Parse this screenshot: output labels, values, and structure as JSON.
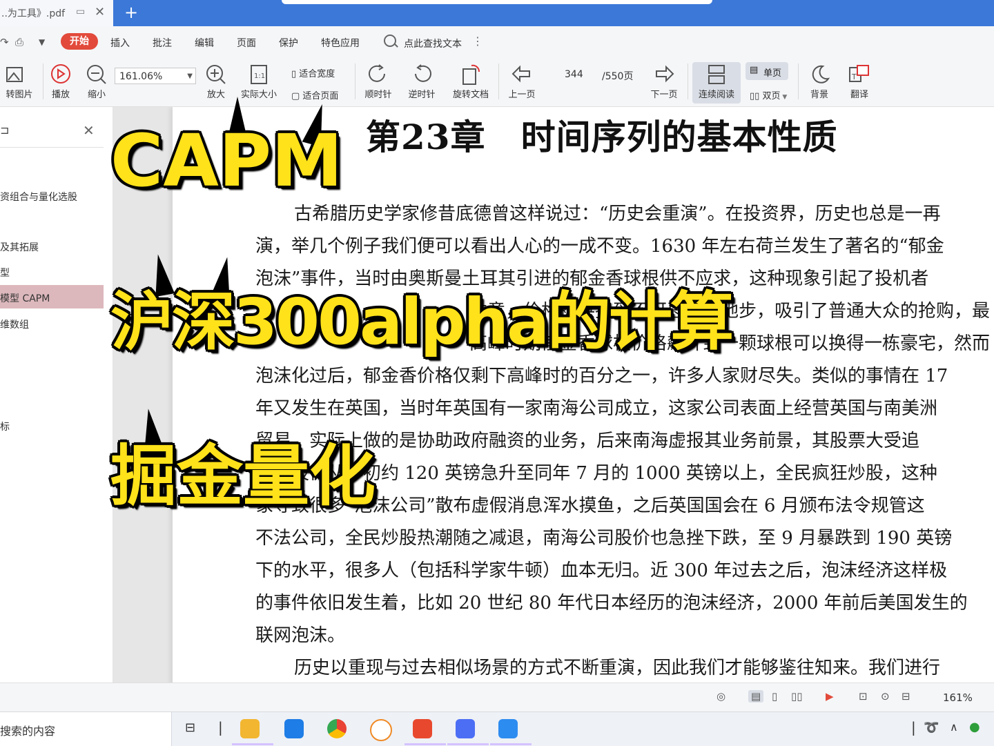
{
  "tab": {
    "title": "..为工具》.pdf",
    "new_tab": "+"
  },
  "menu": {
    "items": [
      "开始",
      "插入",
      "批注",
      "编辑",
      "页面",
      "保护",
      "特色应用"
    ],
    "search_text": "点此查找文本",
    "more": "⋮"
  },
  "toolbar": {
    "to_image": "转图片",
    "play": "播放",
    "zoom_out": "缩小",
    "zoom_value": "161.06%",
    "zoom_in": "放大",
    "actual_size": "实际大小",
    "fit_width": "适合宽度",
    "fit_page": "适合页面",
    "rotate_cw": "顺时针",
    "rotate_ccw": "逆时针",
    "rotate_doc": "旋转文档",
    "prev_page": "上一页",
    "page_current": "344",
    "page_total": "/550页",
    "next_page": "下一页",
    "continuous": "连续阅读",
    "single": "单页",
    "double": "双页",
    "background": "背景",
    "translate": "翻译"
  },
  "sidebar": {
    "items": [
      "资组合与量化选股",
      "及其拓展",
      "型",
      "模型 CAPM",
      "维数组",
      "标"
    ],
    "active_index": 3
  },
  "document": {
    "title": "第23章　时间序列的基本性质",
    "lines": [
      "古希腊历史学家修昔底德曾这样说过：“历史会重演”。在投资界，历史也总是一再",
      "演，举几个例子我们便可以看出人心的一成不变。1630 年左右荷兰发生了著名的“郁金",
      "泡沫”事件，当时由奥斯曼土耳其引进的郁金香球根供不应求，这种现象引起了投机者",
      "注意，价格被哄抬到不可思议的地步，吸引了普通大众的抢购，最",
      "高峰时期郁金香球根价格飙升到一颗球根可以换得一栋豪宅，然而",
      "泡沫化过后，郁金香价格仅剩下高峰时的百分之一，许多人家财尽失。类似的事情在 17",
      "年又发生在英国，当时年英国有一家南海公司成立，这家公司表面上经营英国与南美洲",
      "贸易，实际上做的是协助政府融资的业务，后来南海虚报其业务前景，其股票大受追",
      "捧，股价从年初约 120 英镑急升至同年 7 月的 1000 英镑以上，全民疯狂炒股，这种",
      "象导致很多“泡沫公司”散布虚假消息浑水摸鱼，之后英国国会在 6 月颁布法令规管这",
      "不法公司，全民炒股热潮随之减退，南海公司股价也急挫下跌，至 9 月暴跌到 190 英镑",
      "下的水平，很多人（包括科学家牛顿）血本无归。近 300 年过去之后，泡沫经济这样极",
      "的事件依旧发生着，比如 20 世纪 80 年代日本经历的泡沫经济，2000 年前后美国发生的",
      "联网泡沫。",
      "历史以重现与过去相似场景的方式不断重演，因此我们才能够鉴往知来。我们进行"
    ]
  },
  "overlay": {
    "line1": "CAPM",
    "line2": "沪深300alpha的计算",
    "line3": "掘金量化"
  },
  "statusbar": {
    "zoom": "161%"
  },
  "taskbar": {
    "search_placeholder": "搜索的内容"
  },
  "colors": {
    "accent": "#3b78d8",
    "start_button": "#e24a3b",
    "overlay_text": "#ffe21a",
    "active_toc": "#dcb8bc"
  }
}
